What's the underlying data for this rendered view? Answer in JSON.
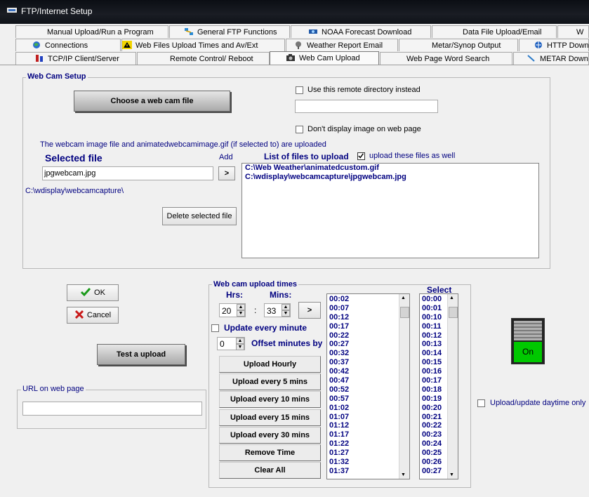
{
  "window": {
    "title": "FTP/Internet Setup"
  },
  "tabs": {
    "row1": [
      {
        "label": "Manual Upload/Run a Program",
        "icon": "none"
      },
      {
        "label": "General FTP Functions",
        "icon": "network-icon"
      },
      {
        "label": "NOAA Forecast Download",
        "icon": "satellite-icon"
      },
      {
        "label": "Data File Upload/Email",
        "icon": "none"
      },
      {
        "label": "W",
        "icon": "none"
      }
    ],
    "row2": [
      {
        "label": "Connections",
        "icon": "globe-icon"
      },
      {
        "label": "Web Files Upload Times and  Av/Ext",
        "icon": "warning-icon"
      },
      {
        "label": "Weather Report Email",
        "icon": "satellite-icon"
      },
      {
        "label": "Metar/Synop Output",
        "icon": "none"
      },
      {
        "label": "HTTP Down",
        "icon": "globe-icon"
      }
    ],
    "row3": [
      {
        "label": "TCP/IP Client/Server",
        "icon": "network-icon"
      },
      {
        "label": "Remote Control/ Reboot",
        "icon": "none"
      },
      {
        "label": "Web Cam Upload",
        "icon": "camera-icon"
      },
      {
        "label": "Web Page Word Search",
        "icon": "none"
      },
      {
        "label": "METAR Down",
        "icon": "arrow-icon"
      }
    ]
  },
  "webcam_setup": {
    "group_label": "Web Cam Setup",
    "choose_button": "Choose a web cam file",
    "remote_dir_checkbox": "Use this remote directory instead",
    "remote_dir_value": "",
    "dont_display_checkbox": "Don't display image on web page",
    "info_text": "The webcam image file and animatedwebcamimage.gif (if selected to) are uploaded",
    "selected_file_label": "Selected file",
    "add_label": "Add",
    "selected_file_value": "jpgwebcam.jpg",
    "add_button": ">",
    "path_text": "C:\\wdisplay\\webcamcapture\\",
    "delete_button": "Delete selected file",
    "list_label": "List of files to upload",
    "upload_checkbox": "upload these files as well",
    "files": [
      "C:\\Web Weather\\animatedcustom.gif",
      "C:\\wdisplay\\webcamcapture\\jpgwebcam.jpg"
    ]
  },
  "dialog_buttons": {
    "ok": "OK",
    "cancel": "Cancel",
    "test": "Test a upload"
  },
  "url_group": {
    "label": "URL on web page",
    "value": ""
  },
  "upload_times": {
    "group_label": "Web cam upload times",
    "hrs_label": "Hrs:",
    "mins_label": "Mins:",
    "hrs_value": "20",
    "mins_value": "33",
    "colon": ":",
    "add_button": ">",
    "update_every_minute": "Update every minute",
    "offset_value": "0",
    "offset_label": "Offset minutes by",
    "buttons": [
      "Upload Hourly",
      "Upload every 5 mins",
      "Upload every 10 mins",
      "Upload every 15 mins",
      "Upload every 30 mins",
      "Remove Time",
      "Clear All"
    ],
    "times_list": [
      "00:02",
      "00:07",
      "00:12",
      "00:17",
      "00:22",
      "00:27",
      "00:32",
      "00:37",
      "00:42",
      "00:47",
      "00:52",
      "00:57",
      "01:02",
      "01:07",
      "01:12",
      "01:17",
      "01:22",
      "01:27",
      "01:32",
      "01:37"
    ],
    "select_label": "Select",
    "select_list": [
      "00:00",
      "00:01",
      "00:10",
      "00:11",
      "00:12",
      "00:13",
      "00:14",
      "00:15",
      "00:16",
      "00:17",
      "00:18",
      "00:19",
      "00:20",
      "00:21",
      "00:22",
      "00:23",
      "00:24",
      "00:25",
      "00:26",
      "00:27"
    ]
  },
  "switch": {
    "label": "On",
    "color": "#00c800"
  },
  "daytime_checkbox": "Upload/update daytime only"
}
